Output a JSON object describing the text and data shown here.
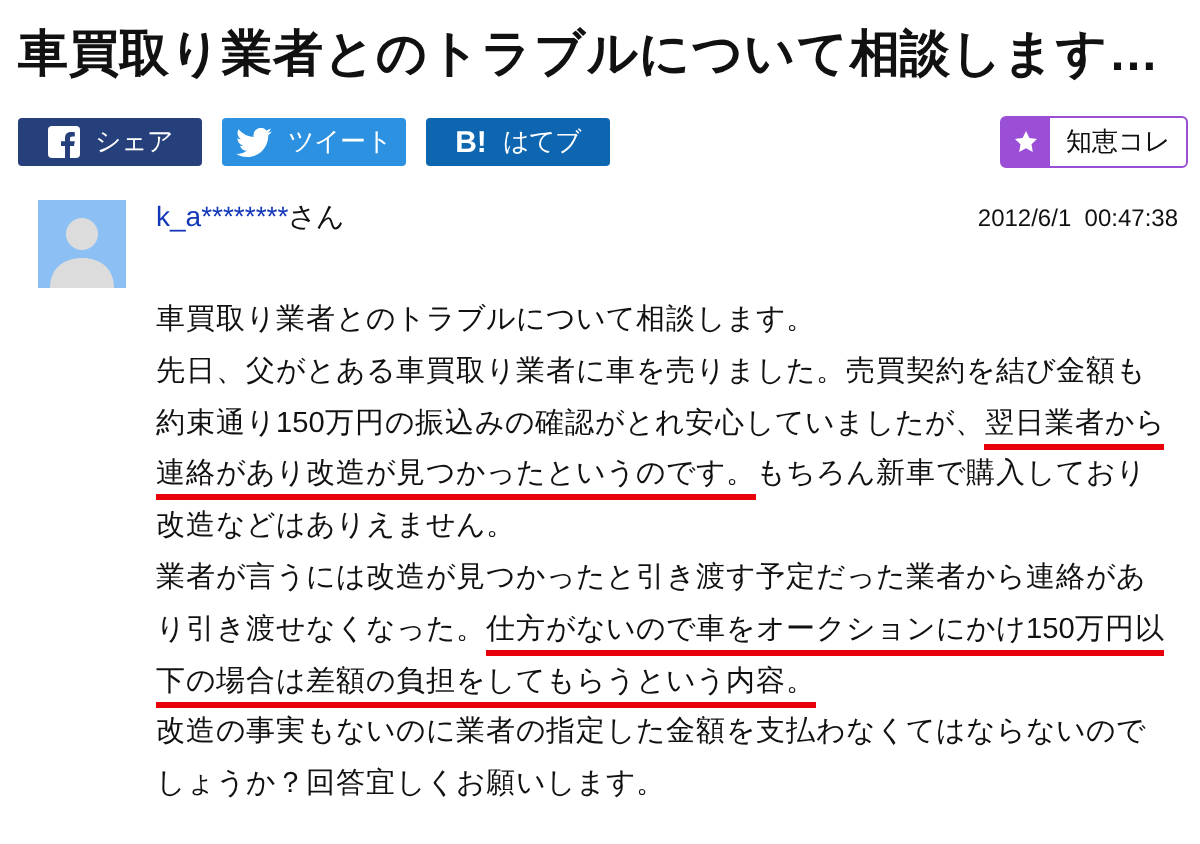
{
  "title": "車買取り業者とのトラブルについて相談します…",
  "share_buttons": [
    {
      "kind": "facebook",
      "label": "シェア"
    },
    {
      "kind": "twitter",
      "label": "ツイート"
    },
    {
      "kind": "hatena",
      "icon_text": "B!",
      "label": "はてブ"
    }
  ],
  "collect_button": {
    "label": "知恵コレ"
  },
  "question": {
    "user": "k_a********",
    "honorific": "さん",
    "datetime": "2012/6/1  00:47:38",
    "lines": [
      [
        {
          "text": "車買取り業者とのトラブルについて相談します。",
          "underlined": false
        }
      ],
      [
        {
          "text": "先日、父がとある車買取り業者に車を売りました。売買契約を結び金額も",
          "underlined": false
        }
      ],
      [
        {
          "text": "約束通り150万円の振込みの確認がとれ安心していましたが、",
          "underlined": false
        },
        {
          "text": "翌日業者から",
          "underlined": true
        }
      ],
      [
        {
          "text": "連絡があり改造が見つかったというのです。",
          "underlined": true
        },
        {
          "text": "もちろん新車で購入しており",
          "underlined": false
        }
      ],
      [
        {
          "text": "改造などはありえません。",
          "underlined": false
        }
      ],
      [
        {
          "text": "業者が言うには改造が見つかったと引き渡す予定だった業者から連絡があ",
          "underlined": false
        }
      ],
      [
        {
          "text": "り引き渡せなくなった。",
          "underlined": false
        },
        {
          "text": "仕方がないので車をオークションにかけ150万円以",
          "underlined": true
        }
      ],
      [
        {
          "text": "下の場合は差額の負担をしてもらうという内容。",
          "underlined": true
        }
      ],
      [
        {
          "text": "改造の事実もないのに業者の指定した金額を支払わなくてはならないので",
          "underlined": false
        }
      ],
      [
        {
          "text": "しょうか？回答宜しくお願いします。",
          "underlined": false
        }
      ]
    ]
  }
}
